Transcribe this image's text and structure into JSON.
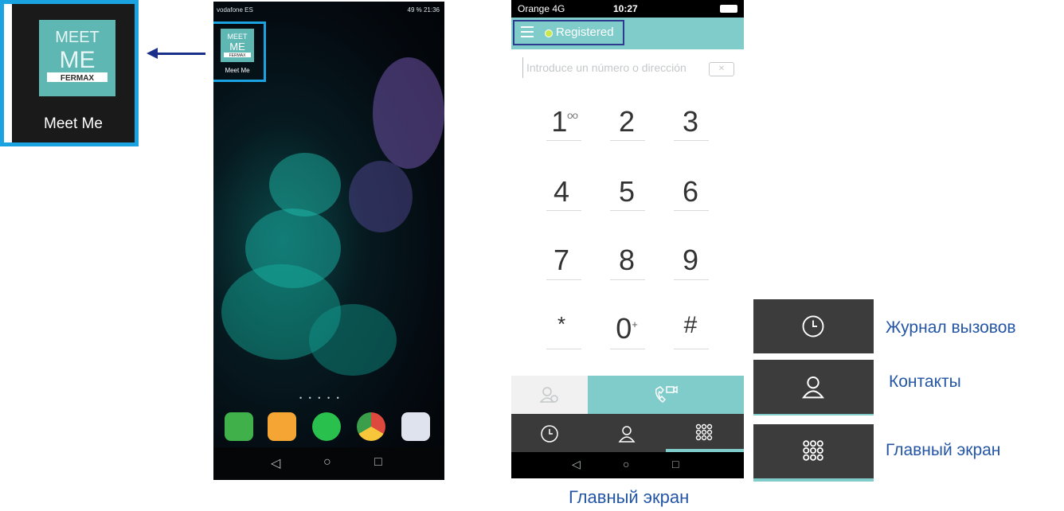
{
  "callout": {
    "app_name": "Meet Me",
    "logo_text": {
      "line1": "MEET",
      "line2": "ME",
      "brand": "FERMAX"
    }
  },
  "android": {
    "status_left": "vodafone ES",
    "status_right": "49 % 21:36",
    "home_icon_label": "Meet Me",
    "dock": [
      {
        "name": "phone-app",
        "color": "#3fb04a"
      },
      {
        "name": "contacts-app",
        "color": "#f4a533"
      },
      {
        "name": "whatsapp-app",
        "color": "#2ac04d"
      },
      {
        "name": "chrome-app",
        "color": "#dd4a3d"
      },
      {
        "name": "camera-app",
        "color": "#dfe3ee"
      }
    ],
    "nav": {
      "back": "◁",
      "home": "○",
      "recents": "□"
    }
  },
  "ios_dialer": {
    "carrier": "Orange  4G",
    "time": "10:27",
    "status": "Registered",
    "input_placeholder": "Introduce un número o dirección",
    "backspace": "✕",
    "keys": [
      {
        "main": "1",
        "sup": "ᴼᴼ"
      },
      {
        "main": "2",
        "sup": ""
      },
      {
        "main": "3",
        "sup": ""
      },
      {
        "main": "4",
        "sup": ""
      },
      {
        "main": "5",
        "sup": ""
      },
      {
        "main": "6",
        "sup": ""
      },
      {
        "main": "7",
        "sup": ""
      },
      {
        "main": "8",
        "sup": ""
      },
      {
        "main": "9",
        "sup": ""
      },
      {
        "main": "*",
        "sup": ""
      },
      {
        "main": "0",
        "sup": "+"
      },
      {
        "main": "#",
        "sup": ""
      }
    ],
    "nav": {
      "back": "◁",
      "home": "○",
      "recents": "□"
    },
    "caption": "Главный экран"
  },
  "legend": {
    "items": [
      {
        "icon": "clock-icon",
        "label": "Журнал вызовов"
      },
      {
        "icon": "contact-icon",
        "label": "Контакты"
      },
      {
        "icon": "keypad-icon",
        "label": "Главный экран"
      }
    ]
  },
  "colors": {
    "accent": "#7fcccb",
    "highlight": "#1aa3e0",
    "caption": "#2456a5",
    "dark_tab": "#3c3c3c"
  }
}
